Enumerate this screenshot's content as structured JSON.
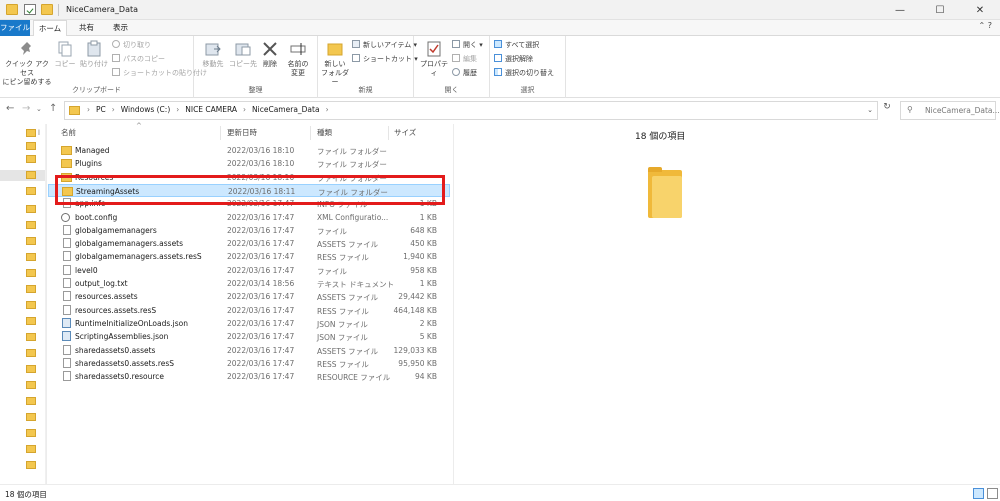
{
  "window": {
    "title": "NiceCamera_Data",
    "controls": {
      "minimize": "—",
      "maximize": "☐",
      "close": "✕"
    }
  },
  "ribbon_tabs": {
    "file": "ファイル",
    "home": "ホーム",
    "share": "共有",
    "view": "表示"
  },
  "ribbon": {
    "clipboard": {
      "pin": "クイック アクセス\nにピン留めする",
      "copy": "コピー",
      "paste": "貼り付け",
      "cut": "切り取り",
      "copy_path": "パスのコピー",
      "paste_shortcut": "ショートカットの貼り付け",
      "label": "クリップボード"
    },
    "organize": {
      "move_to": "移動先",
      "copy_to": "コピー先",
      "delete": "削除",
      "rename": "名前の\n変更",
      "label": "整理"
    },
    "new": {
      "new_folder": "新しい\nフォルダー",
      "new_item": "新しいアイテム ▾",
      "easy_access": "ショートカット ▾",
      "label": "新規"
    },
    "open": {
      "properties": "プロパティ",
      "open": "開く ▾",
      "edit": "編集",
      "history": "履歴",
      "label": "開く"
    },
    "select": {
      "select_all": "すべて選択",
      "select_none": "選択解除",
      "invert": "選択の切り替え",
      "label": "選択"
    }
  },
  "address": {
    "crumbs": [
      "PC",
      "Windows (C:)",
      "NICE CAMERA",
      "NiceCamera_Data"
    ],
    "search_placeholder": "NiceCamera_Data..."
  },
  "columns": {
    "name": "名前",
    "date": "更新日時",
    "type": "種類",
    "size": "サイズ"
  },
  "files": [
    {
      "name": "Managed",
      "date": "2022/03/16 18:10",
      "type": "ファイル フォルダー",
      "size": "",
      "icon": "folder"
    },
    {
      "name": "Plugins",
      "date": "2022/03/16 18:10",
      "type": "ファイル フォルダー",
      "size": "",
      "icon": "folder"
    },
    {
      "name": "Resources",
      "date": "2022/03/16 18:10",
      "type": "ファイル フォルダー",
      "size": "",
      "icon": "folder"
    },
    {
      "name": "StreamingAssets",
      "date": "2022/03/16 18:11",
      "type": "ファイル フォルダー",
      "size": "",
      "icon": "folder"
    },
    {
      "name": "app.info",
      "date": "2022/03/16 17:47",
      "type": "INFO ファイル",
      "size": "1 KB",
      "icon": "doc"
    },
    {
      "name": "boot.config",
      "date": "2022/03/16 17:47",
      "type": "XML Configuratio...",
      "size": "1 KB",
      "icon": "gear"
    },
    {
      "name": "globalgamemanagers",
      "date": "2022/03/16 17:47",
      "type": "ファイル",
      "size": "648 KB",
      "icon": "doc"
    },
    {
      "name": "globalgamemanagers.assets",
      "date": "2022/03/16 17:47",
      "type": "ASSETS ファイル",
      "size": "450 KB",
      "icon": "doc"
    },
    {
      "name": "globalgamemanagers.assets.resS",
      "date": "2022/03/16 17:47",
      "type": "RESS ファイル",
      "size": "1,940 KB",
      "icon": "doc"
    },
    {
      "name": "level0",
      "date": "2022/03/16 17:47",
      "type": "ファイル",
      "size": "958 KB",
      "icon": "doc"
    },
    {
      "name": "output_log.txt",
      "date": "2022/03/14 18:56",
      "type": "テキスト ドキュメント",
      "size": "1 KB",
      "icon": "doc"
    },
    {
      "name": "resources.assets",
      "date": "2022/03/16 17:47",
      "type": "ASSETS ファイル",
      "size": "29,442 KB",
      "icon": "doc"
    },
    {
      "name": "resources.assets.resS",
      "date": "2022/03/16 17:47",
      "type": "RESS ファイル",
      "size": "464,148 KB",
      "icon": "doc"
    },
    {
      "name": "RuntimeInitializeOnLoads.json",
      "date": "2022/03/16 17:47",
      "type": "JSON ファイル",
      "size": "2 KB",
      "icon": "json"
    },
    {
      "name": "ScriptingAssemblies.json",
      "date": "2022/03/16 17:47",
      "type": "JSON ファイル",
      "size": "5 KB",
      "icon": "json"
    },
    {
      "name": "sharedassets0.assets",
      "date": "2022/03/16 17:47",
      "type": "ASSETS ファイル",
      "size": "129,033 KB",
      "icon": "doc"
    },
    {
      "name": "sharedassets0.assets.resS",
      "date": "2022/03/16 17:47",
      "type": "RESS ファイル",
      "size": "95,950 KB",
      "icon": "doc"
    },
    {
      "name": "sharedassets0.resource",
      "date": "2022/03/16 17:47",
      "type": "RESOURCE ファイル",
      "size": "94 KB",
      "icon": "doc"
    }
  ],
  "highlighted_file": "StreamingAssets",
  "preview": {
    "count": "18 個の項目"
  },
  "status": {
    "count": "18 個の項目"
  },
  "colors": {
    "accent": "#1979ca",
    "highlight_box": "#e31b1b",
    "folder": "#f3c74f",
    "selection": "#cce8ff"
  }
}
